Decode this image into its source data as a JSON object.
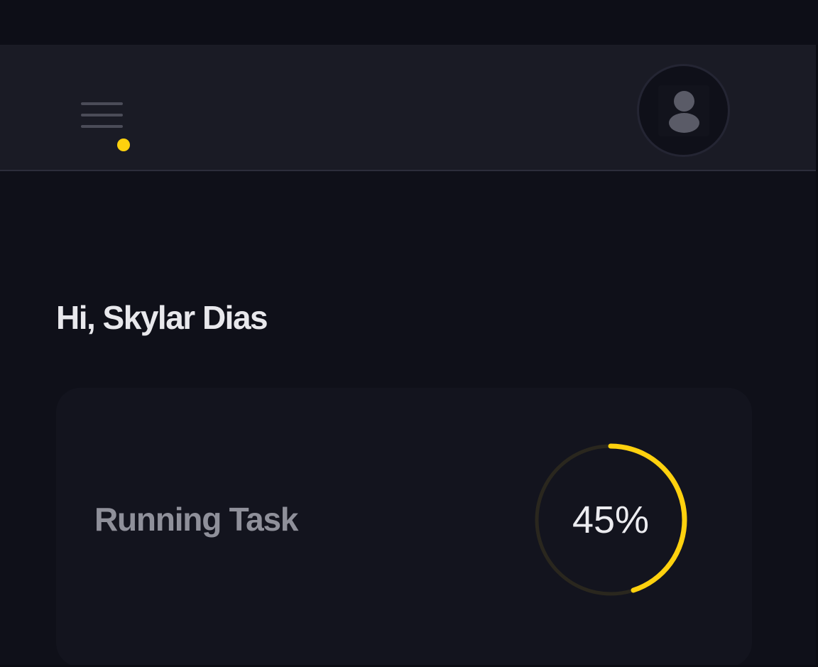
{
  "header": {
    "menu_icon": "hamburger-menu-icon",
    "notification_color": "#fed10e",
    "avatar_icon": "user-avatar-icon"
  },
  "greeting": {
    "text": "Hi, Skylar Dias"
  },
  "task_card": {
    "title": "Running Task",
    "progress_label": "45%",
    "progress_fraction": 0.45,
    "progress_color": "#fed10e",
    "track_color": "#2a271e"
  },
  "colors": {
    "background": "#0f1019",
    "header_background": "#1a1b25",
    "card_background": "#13141e",
    "accent": "#fed10e"
  }
}
